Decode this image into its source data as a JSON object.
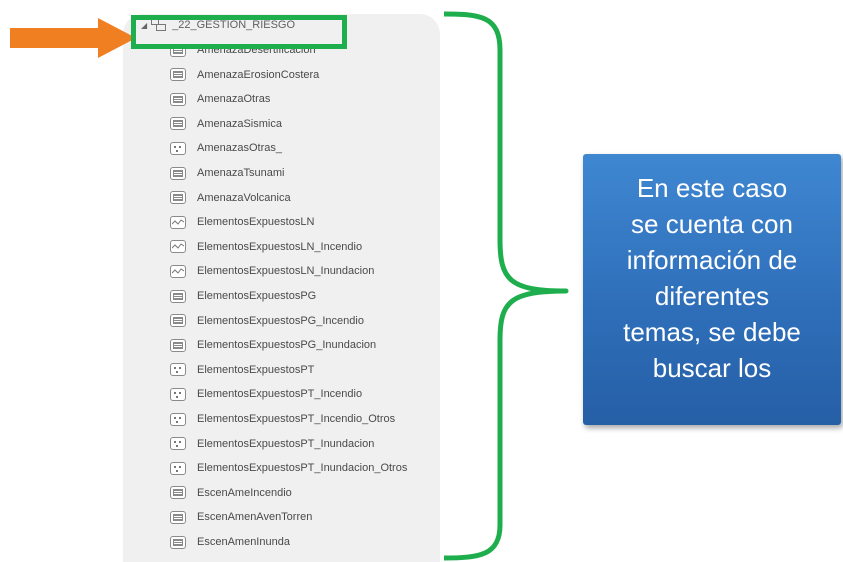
{
  "dataset": {
    "name": "_22_GESTION_RIESGO",
    "icon": "feature-dataset-icon"
  },
  "layers": [
    {
      "name": "AmenazaDesertificacion",
      "type": "raster"
    },
    {
      "name": "AmenazaErosionCostera",
      "type": "raster"
    },
    {
      "name": "AmenazaOtras",
      "type": "raster"
    },
    {
      "name": "AmenazaSismica",
      "type": "raster"
    },
    {
      "name": "AmenazasOtras_",
      "type": "point"
    },
    {
      "name": "AmenazaTsunami",
      "type": "raster"
    },
    {
      "name": "AmenazaVolcanica",
      "type": "raster"
    },
    {
      "name": "ElementosExpuestosLN",
      "type": "line"
    },
    {
      "name": "ElementosExpuestosLN_Incendio",
      "type": "line"
    },
    {
      "name": "ElementosExpuestosLN_Inundacion",
      "type": "line"
    },
    {
      "name": "ElementosExpuestosPG",
      "type": "raster"
    },
    {
      "name": "ElementosExpuestosPG_Incendio",
      "type": "raster"
    },
    {
      "name": "ElementosExpuestosPG_Inundacion",
      "type": "raster"
    },
    {
      "name": "ElementosExpuestosPT",
      "type": "point"
    },
    {
      "name": "ElementosExpuestosPT_Incendio",
      "type": "point"
    },
    {
      "name": "ElementosExpuestosPT_Incendio_Otros",
      "type": "point"
    },
    {
      "name": "ElementosExpuestosPT_Inundacion",
      "type": "point"
    },
    {
      "name": "ElementosExpuestosPT_Inundacion_Otros",
      "type": "point"
    },
    {
      "name": "EscenAmeIncendio",
      "type": "raster"
    },
    {
      "name": "EscenAmenAvenTorren",
      "type": "raster"
    },
    {
      "name": "EscenAmenInunda",
      "type": "raster"
    }
  ],
  "callout": {
    "lines": [
      "En este caso",
      "se cuenta con",
      "información de",
      "diferentes",
      "temas, se debe",
      "buscar los"
    ]
  },
  "colors": {
    "arrow": "#f07f22",
    "highlight": "#1fae4e",
    "brace": "#1fae4e",
    "callout_bg": "#2f6fba",
    "panel_bg": "#f0f0f0"
  }
}
